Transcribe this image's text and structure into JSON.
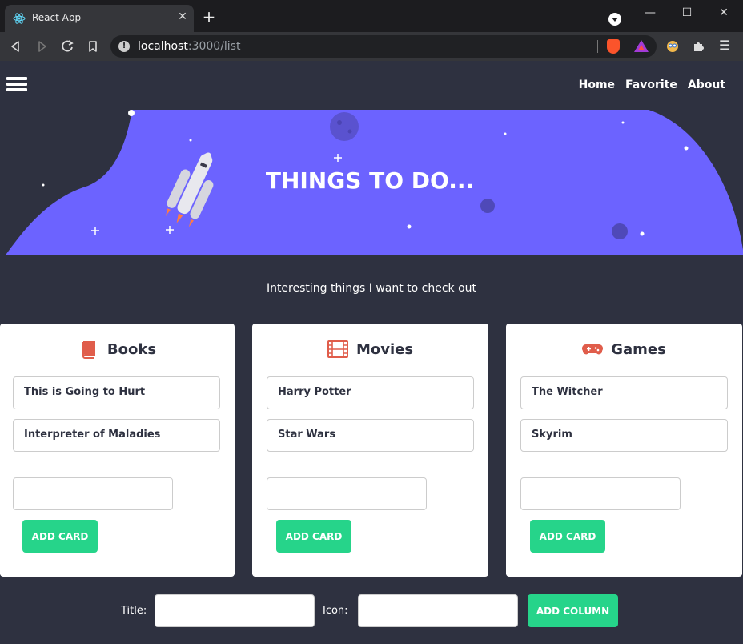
{
  "browser": {
    "tab_title": "React App",
    "tab_close": "✕",
    "new_tab": "+",
    "window_minimize": "—",
    "window_maximize": "☐",
    "window_close": "✕",
    "address_host": "localhost",
    "address_path": ":3000/list",
    "menu_glyph": "☰"
  },
  "nav": {
    "links": [
      "Home",
      "Favorite",
      "About"
    ]
  },
  "hero": {
    "title": "THINGS TO DO...",
    "background_color": "#6c63ff"
  },
  "subtitle": "Interesting things I want to check out",
  "columns": [
    {
      "title": "Books",
      "icon": "book-icon",
      "items": [
        "This is Going to Hurt",
        "Interpreter of Maladies"
      ],
      "input_value": "",
      "add_label": "ADD CARD"
    },
    {
      "title": "Movies",
      "icon": "film-icon",
      "items": [
        "Harry Potter",
        "Star Wars"
      ],
      "input_value": "",
      "add_label": "ADD CARD"
    },
    {
      "title": "Games",
      "icon": "gamepad-icon",
      "items": [
        "The Witcher",
        "Skyrim"
      ],
      "input_value": "",
      "add_label": "ADD CARD"
    }
  ],
  "column_form": {
    "title_label": "Title:",
    "icon_label": "Icon:",
    "title_value": "",
    "icon_value": "",
    "add_label": "ADD COLUMN"
  },
  "colors": {
    "accent_green": "#26d48a",
    "icon_red": "#e05d4b",
    "page_bg": "#2e3140"
  }
}
